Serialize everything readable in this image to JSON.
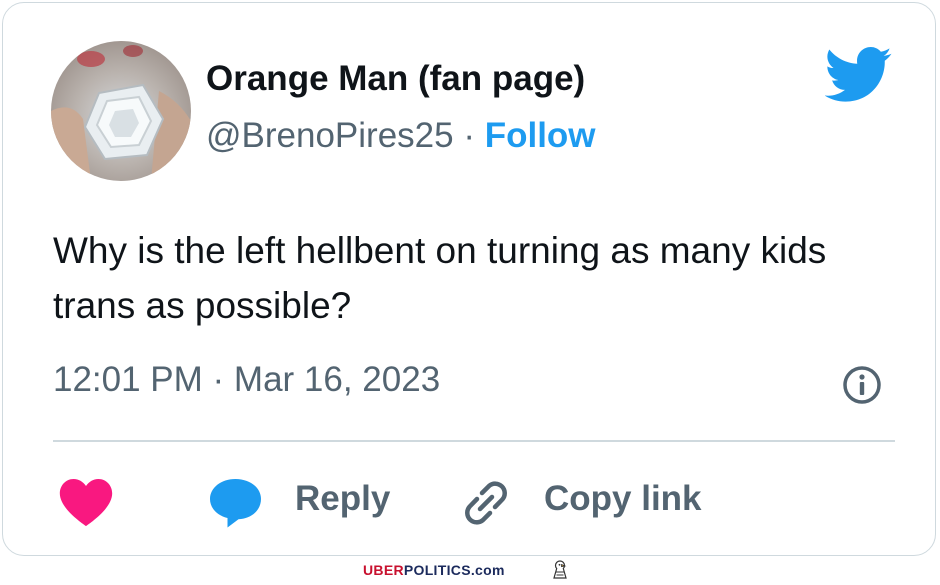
{
  "tweet": {
    "author": {
      "display_name": "Orange Man (fan page)",
      "handle": "@BrenoPires25",
      "separator": " · ",
      "follow_label": "Follow"
    },
    "text": "Why is the left hellbent on turning as many kids trans as possible?",
    "timestamp": "12:01 PM · Mar 16, 2023",
    "actions": {
      "reply_label": "Reply",
      "copy_link_label": "Copy link"
    }
  },
  "watermark": {
    "brand_red": "UBER",
    "brand_navy": "POLITICS.com"
  },
  "colors": {
    "brand_blue": "#1d9bf0",
    "heart_pink": "#f91880",
    "text_primary": "#0f1419",
    "text_secondary": "#536471",
    "divider": "#cfd9de"
  },
  "icons": [
    "bird-logo-icon",
    "info-icon",
    "heart-icon",
    "reply-bubble-icon",
    "link-icon",
    "eagle-icon"
  ]
}
